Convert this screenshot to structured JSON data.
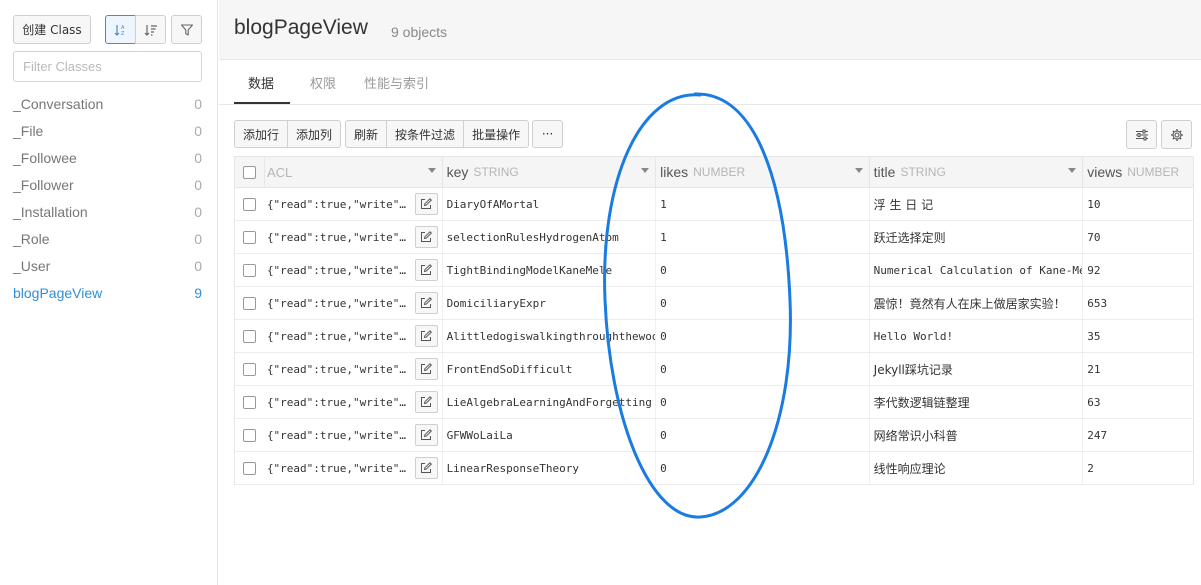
{
  "sidebar": {
    "create_label": "创建 Class",
    "sort_icon": "sort-asc-icon",
    "sort_desc_icon": "sort-desc-icon",
    "filter_icon": "funnel-icon",
    "filter_placeholder": "Filter Classes",
    "classes": [
      {
        "name": "_Conversation",
        "count": "0"
      },
      {
        "name": "_File",
        "count": "0"
      },
      {
        "name": "_Followee",
        "count": "0"
      },
      {
        "name": "_Follower",
        "count": "0"
      },
      {
        "name": "_Installation",
        "count": "0"
      },
      {
        "name": "_Role",
        "count": "0"
      },
      {
        "name": "_User",
        "count": "0"
      },
      {
        "name": "blogPageView",
        "count": "9",
        "active": true
      }
    ]
  },
  "header": {
    "title": "blogPageView",
    "count": "9 objects"
  },
  "tabs": [
    {
      "label": "数据",
      "active": true
    },
    {
      "label": "权限"
    },
    {
      "label": "性能与索引"
    }
  ],
  "toolbar": {
    "add_row": "添加行",
    "add_col": "添加列",
    "refresh": "刷新",
    "filter": "按条件过滤",
    "batch": "批量操作",
    "more": "···"
  },
  "table": {
    "columns": [
      {
        "name": "ACL",
        "type": ""
      },
      {
        "name": "key",
        "type": "STRING"
      },
      {
        "name": "likes",
        "type": "NUMBER"
      },
      {
        "name": "title",
        "type": "STRING"
      },
      {
        "name": "views",
        "type": "NUMBER"
      }
    ],
    "rows": [
      {
        "acl": "{\"read\":true,\"write\"…",
        "key": "DiaryOfAMortal",
        "likes": "1",
        "title": "浮 生 日 记",
        "views": "10"
      },
      {
        "acl": "{\"read\":true,\"write\"…",
        "key": "selectionRulesHydrogenAtom",
        "likes": "1",
        "title": "跃迁选择定则",
        "views": "70"
      },
      {
        "acl": "{\"read\":true,\"write\"…",
        "key": "TightBindingModelKaneMele",
        "likes": "0",
        "title": "Numerical Calculation of Kane-Mele",
        "views": "92"
      },
      {
        "acl": "{\"read\":true,\"write\"…",
        "key": "DomiciliaryExpr",
        "likes": "0",
        "title": "震惊！竟然有人在床上做居家实验！",
        "views": "653"
      },
      {
        "acl": "{\"read\":true,\"write\"…",
        "key": "Alittledogiswalkingthroughthewoods",
        "likes": "0",
        "title": "Hello World!",
        "views": "35"
      },
      {
        "acl": "{\"read\":true,\"write\"…",
        "key": "FrontEndSoDifficult",
        "likes": "0",
        "title": "Jekyll踩坑记录",
        "views": "21"
      },
      {
        "acl": "{\"read\":true,\"write\"…",
        "key": "LieAlgebraLearningAndForgetting",
        "likes": "0",
        "title": "李代数逻辑链整理",
        "views": "63"
      },
      {
        "acl": "{\"read\":true,\"write\"…",
        "key": "GFWWoLaiLa",
        "likes": "0",
        "title": "网络常识小科普",
        "views": "247"
      },
      {
        "acl": "{\"read\":true,\"write\"…",
        "key": "LinearResponseTheory",
        "likes": "0",
        "title": "线性响应理论",
        "views": "2"
      }
    ]
  },
  "colors": {
    "accent": "#2f8fd8",
    "annotation": "#1a7be0"
  }
}
